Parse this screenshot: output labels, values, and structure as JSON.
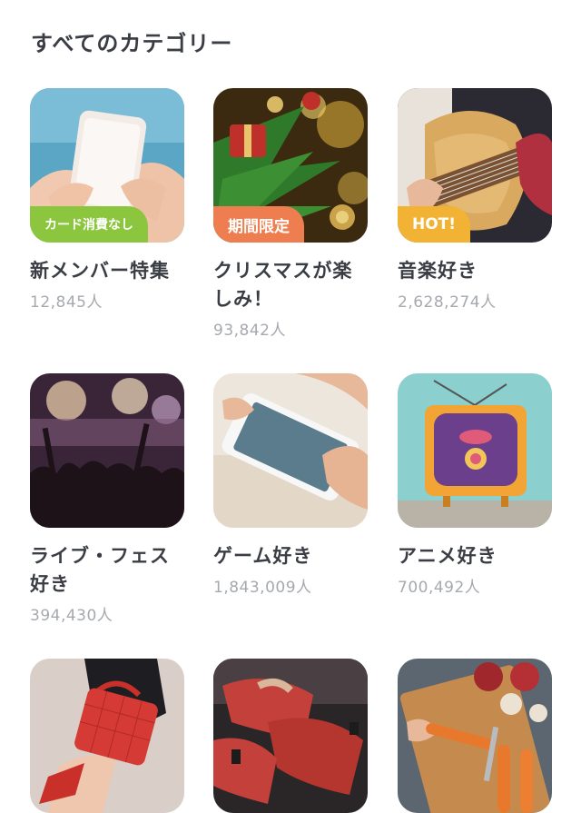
{
  "section": {
    "title": "すべてのカテゴリー"
  },
  "categories": [
    {
      "title": "新メンバー特集",
      "count": "12,845人",
      "badge": "カード消費なし",
      "badge_color": "#8cc63f",
      "image": "smartphone-hands"
    },
    {
      "title": "クリスマスが楽しみ！",
      "count": "93,842人",
      "badge": "期間限定",
      "badge_color": "#ee7e4f",
      "image": "christmas-tree"
    },
    {
      "title": "音楽好き",
      "count": "2,628,274人",
      "badge": "HOT!",
      "badge_color": "#f2b233",
      "image": "guitar"
    },
    {
      "title": "ライブ・フェス好き",
      "count": "394,430人",
      "badge": "",
      "badge_color": "",
      "image": "concert-crowd"
    },
    {
      "title": "ゲーム好き",
      "count": "1,843,009人",
      "badge": "",
      "badge_color": "",
      "image": "phone-game"
    },
    {
      "title": "アニメ好き",
      "count": "700,492人",
      "badge": "",
      "badge_color": "",
      "image": "retro-tv"
    },
    {
      "title": "",
      "count": "",
      "badge": "",
      "badge_color": "",
      "image": "red-handbag"
    },
    {
      "title": "",
      "count": "",
      "badge": "",
      "badge_color": "",
      "image": "boxing-wraps"
    },
    {
      "title": "",
      "count": "",
      "badge": "",
      "badge_color": "",
      "image": "cooking-vegetables"
    }
  ]
}
